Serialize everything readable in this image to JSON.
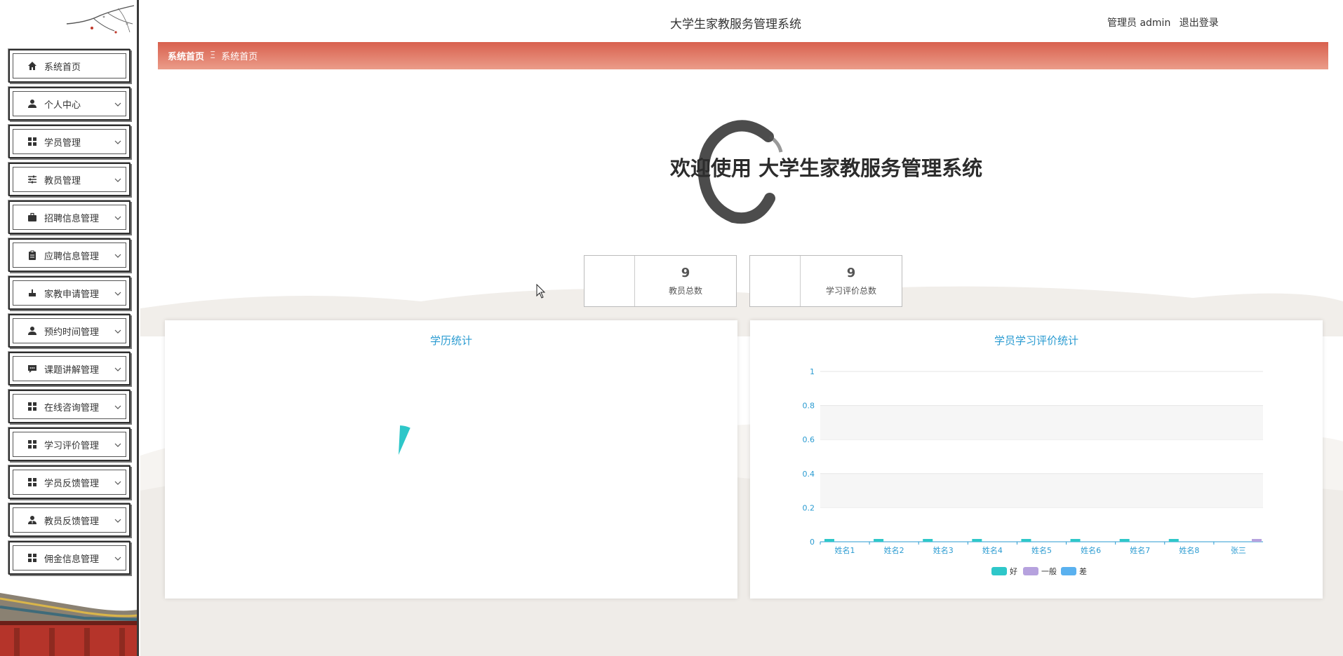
{
  "header": {
    "app_title": "大学生家教服务管理系统",
    "admin_label": "管理员 admin",
    "logout_label": "退出登录"
  },
  "breadcrumb": {
    "home": "系统首页",
    "separator": "Ξ",
    "current": "系统首页"
  },
  "welcome": {
    "text": "欢迎使用 大学生家教服务管理系统"
  },
  "sidebar": {
    "items": [
      {
        "label": "系统首页",
        "icon": "home-icon",
        "expandable": false
      },
      {
        "label": "个人中心",
        "icon": "user-icon",
        "expandable": true
      },
      {
        "label": "学员管理",
        "icon": "grid-icon",
        "expandable": true
      },
      {
        "label": "教员管理",
        "icon": "sliders-icon",
        "expandable": true
      },
      {
        "label": "招聘信息管理",
        "icon": "briefcase-icon",
        "expandable": true
      },
      {
        "label": "应聘信息管理",
        "icon": "clipboard-icon",
        "expandable": true
      },
      {
        "label": "家教申请管理",
        "icon": "hand-icon",
        "expandable": true
      },
      {
        "label": "预约时间管理",
        "icon": "user-icon",
        "expandable": true
      },
      {
        "label": "课题讲解管理",
        "icon": "comment-icon",
        "expandable": true
      },
      {
        "label": "在线咨询管理",
        "icon": "grid-icon",
        "expandable": true
      },
      {
        "label": "学习评价管理",
        "icon": "grid-icon",
        "expandable": true
      },
      {
        "label": "学员反馈管理",
        "icon": "grid-icon",
        "expandable": true
      },
      {
        "label": "教员反馈管理",
        "icon": "user-tie-icon",
        "expandable": true
      },
      {
        "label": "佣金信息管理",
        "icon": "grid-icon",
        "expandable": true
      }
    ]
  },
  "stats": [
    {
      "value": "9",
      "label": "教员总数"
    },
    {
      "value": "9",
      "label": "学习评价总数"
    }
  ],
  "panels": {
    "left_title": "学历统计",
    "right_title": "学员学习评价统计"
  },
  "colors": {
    "accent": "#d8604e",
    "title_blue": "#2a9bd1",
    "series_good": "#2ec7c9",
    "series_mid": "#b6a2de",
    "series_bad": "#5ab1ef"
  },
  "chart_data": [
    {
      "type": "pie",
      "title": "学历统计",
      "slices": [
        {
          "label": "",
          "value": 1
        }
      ]
    },
    {
      "type": "bar",
      "title": "学员学习评价统计",
      "categories": [
        "姓名1",
        "姓名2",
        "姓名3",
        "姓名4",
        "姓名5",
        "姓名6",
        "姓名7",
        "姓名8",
        "张三"
      ],
      "series": [
        {
          "name": "好",
          "values": [
            0.01,
            0.01,
            0.01,
            0.01,
            0.01,
            0.01,
            0.01,
            0.01,
            0
          ]
        },
        {
          "name": "一般",
          "values": [
            0,
            0,
            0,
            0,
            0,
            0,
            0,
            0,
            0.01
          ]
        },
        {
          "name": "差",
          "values": [
            0,
            0,
            0,
            0,
            0,
            0,
            0,
            0,
            0
          ]
        }
      ],
      "ylim": [
        0,
        1
      ],
      "yticks": [
        "0",
        "0.2",
        "0.4",
        "0.6",
        "0.8",
        "1"
      ],
      "legend": "bottom-center",
      "grid": true
    }
  ]
}
